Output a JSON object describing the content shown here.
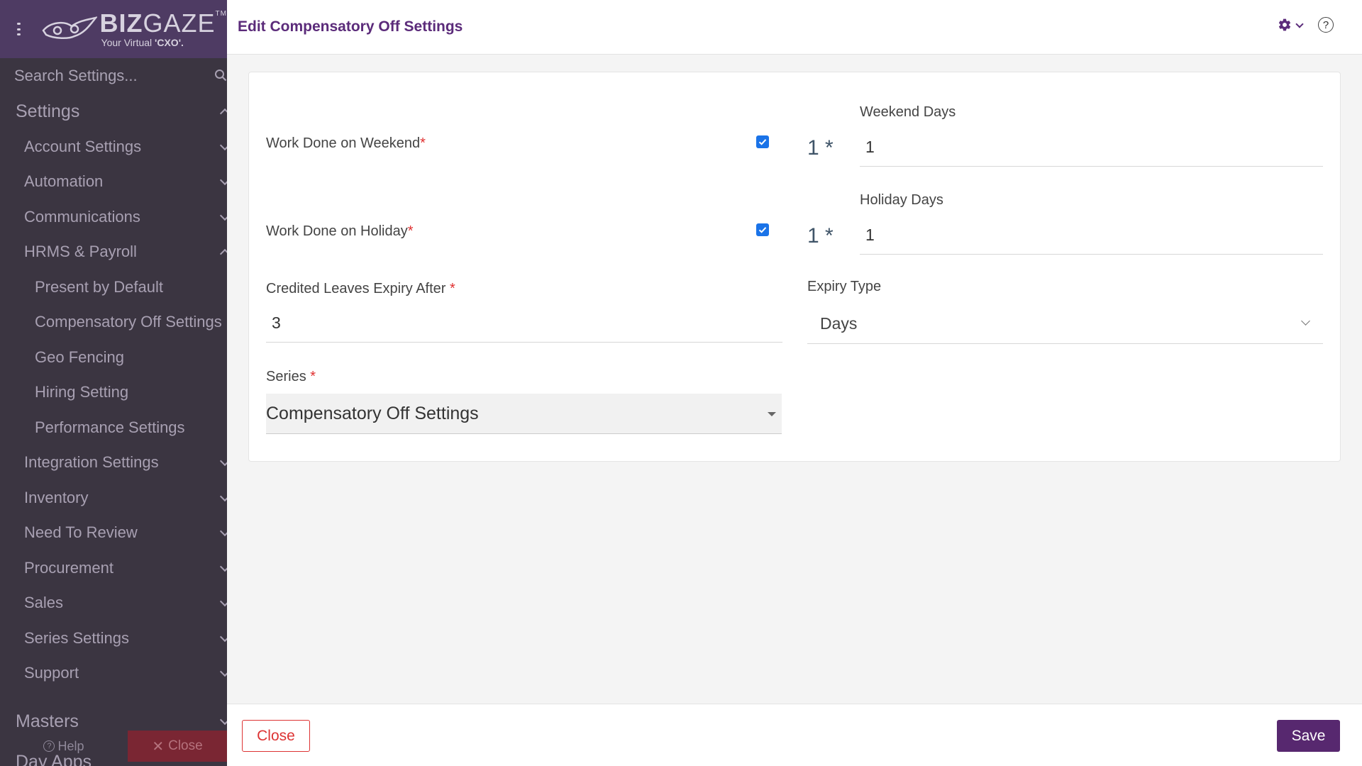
{
  "sidebar": {
    "logo": {
      "brand_bold": "BIZ",
      "brand_light": "GAZE",
      "trademark": "TM",
      "tagline": "Your Virtual ",
      "tagline_bold": "'CXO'."
    },
    "search_placeholder": "Search Settings...",
    "section_settings": "Settings",
    "items": [
      {
        "label": "Account Settings"
      },
      {
        "label": "Automation"
      },
      {
        "label": "Communications"
      },
      {
        "label": "HRMS & Payroll"
      },
      {
        "label": "Present by Default"
      },
      {
        "label": "Compensatory Off Settings"
      },
      {
        "label": "Geo Fencing"
      },
      {
        "label": "Hiring Setting"
      },
      {
        "label": "Performance Settings"
      },
      {
        "label": "Integration Settings"
      },
      {
        "label": "Inventory"
      },
      {
        "label": "Need To Review"
      },
      {
        "label": "Procurement"
      },
      {
        "label": "Sales"
      },
      {
        "label": "Series Settings"
      },
      {
        "label": "Support"
      }
    ],
    "section_masters": "Masters",
    "section_overflow": "Day Apps",
    "help_label": "Help",
    "close_label": "Close"
  },
  "header": {
    "title": "Edit Compensatory Off Settings",
    "icons": [
      "gear-icon",
      "chevron-down-icon",
      "help-icon"
    ]
  },
  "form": {
    "weekend": {
      "label": "Work Done on Weekend",
      "required_mark": "*",
      "checked": true,
      "prefix": "1 *",
      "days_label": "Weekend Days",
      "days_value": "1"
    },
    "holiday": {
      "label": "Work Done on Holiday",
      "required_mark": "*",
      "checked": true,
      "prefix": "1 *",
      "days_label": "Holiday Days",
      "days_value": "1"
    },
    "expiry": {
      "label": "Credited Leaves Expiry After ",
      "required_mark": "*",
      "value": "3"
    },
    "expiry_type": {
      "label": "Expiry Type",
      "value": "Days"
    },
    "series": {
      "label": "Series ",
      "required_mark": "*",
      "value": "Compensatory Off Settings"
    }
  },
  "footer": {
    "close_label": "Close",
    "save_label": "Save"
  },
  "colors": {
    "brand": "#57286f",
    "sidebar_bg": "#3b3541",
    "checkbox": "#1a73e8",
    "required": "#e03030"
  }
}
